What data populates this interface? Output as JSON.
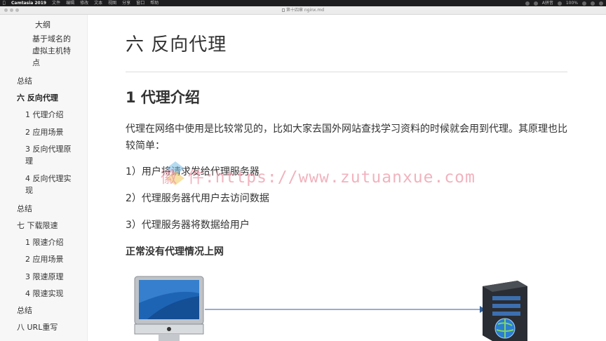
{
  "menubar": {
    "app_name": "Camtasia 2019",
    "items": [
      "文件",
      "编辑",
      "修改",
      "文本",
      "视图",
      "分享",
      "窗口",
      "帮助"
    ],
    "input_method": "A拼音",
    "battery": "100%"
  },
  "window": {
    "title": "第十四章 nginx.md"
  },
  "sidebar": {
    "items": [
      {
        "label": "大纲"
      },
      {
        "label": "基于域名的虚拟主机特点"
      },
      {
        "label": "总结"
      },
      {
        "label": "六 反向代理"
      },
      {
        "label": "1 代理介绍"
      },
      {
        "label": "2 应用场景"
      },
      {
        "label": "3 反向代理原理"
      },
      {
        "label": "4 反向代理实现"
      },
      {
        "label": "总结"
      },
      {
        "label": "七 下载限速"
      },
      {
        "label": "1 限速介绍"
      },
      {
        "label": "2 应用场景"
      },
      {
        "label": "3 限速原理"
      },
      {
        "label": "4 限速实现"
      },
      {
        "label": "总结"
      },
      {
        "label": "八 URL重写"
      }
    ]
  },
  "content": {
    "h1": "六 反向代理",
    "h2": "1 代理介绍",
    "paragraph": "代理在网络中使用是比较常见的，比如大家去国外网站查找学习资料的时候就会用到代理。其原理也比较简单：",
    "list": [
      "1）用户将请求发给代理服务器",
      "2）代理服务器代用户去访问数据",
      "3）代理服务器将数据给用户"
    ],
    "h4": "正常没有代理情况上网"
  },
  "watermark": {
    "text": "徽 件:https://www.zutuanxue.com"
  },
  "colors": {
    "arrow": "#2f5f9e",
    "watermark": "#eb96a5",
    "sidebar_bg": "#f7f7f7"
  }
}
